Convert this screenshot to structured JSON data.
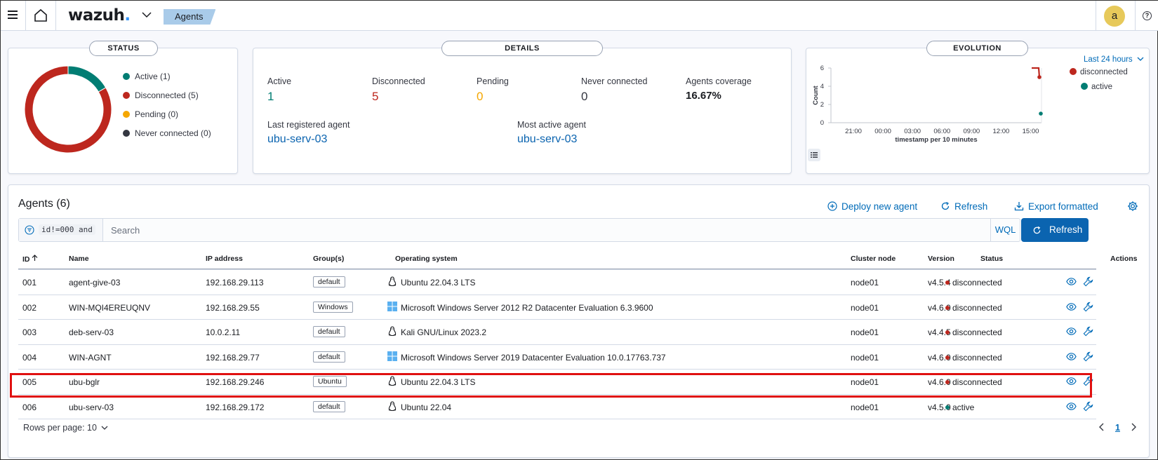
{
  "header": {
    "logo": "wazuh",
    "logo_dot": ".",
    "breadcrumb": "Agents",
    "avatar_letter": "a",
    "help": "?"
  },
  "status_panel": {
    "title": "STATUS",
    "legend": [
      {
        "label": "Active (1)",
        "color": "#017d73"
      },
      {
        "label": "Disconnected (5)",
        "color": "#bd271e"
      },
      {
        "label": "Pending (0)",
        "color": "#f5a700"
      },
      {
        "label": "Never connected (0)",
        "color": "#343741"
      }
    ],
    "donut": {
      "active": 1,
      "disconnected": 5,
      "pending": 0,
      "never_connected": 0
    }
  },
  "details_panel": {
    "title": "DETAILS",
    "stats": [
      {
        "label": "Active",
        "value": "1",
        "color": "#017d73"
      },
      {
        "label": "Disconnected",
        "value": "5",
        "color": "#bd271e"
      },
      {
        "label": "Pending",
        "value": "0",
        "color": "#f5a700"
      },
      {
        "label": "Never connected",
        "value": "0",
        "color": "#343741"
      },
      {
        "label": "Agents coverage",
        "value": "16.67%",
        "color": "#1a1c21"
      }
    ],
    "last_registered_label": "Last registered agent",
    "last_registered_value": "ubu-serv-03",
    "most_active_label": "Most active agent",
    "most_active_value": "ubu-serv-03"
  },
  "evolution_panel": {
    "title": "EVOLUTION",
    "range": "Last 24 hours",
    "legend": [
      {
        "label": "disconnected",
        "color": "#bd271e"
      },
      {
        "label": "active",
        "color": "#017d73"
      }
    ]
  },
  "chart_data": {
    "type": "line",
    "ylabel": "Count",
    "xlabel": "timestamp per 10 minutes",
    "y_ticks": [
      "0",
      "2",
      "4",
      "6"
    ],
    "x_ticks": [
      "21:00",
      "00:00",
      "03:00",
      "06:00",
      "09:00",
      "12:00",
      "15:00"
    ],
    "ylim": [
      0,
      6
    ],
    "series": [
      {
        "name": "disconnected",
        "color": "#bd271e",
        "values": [
          6,
          6,
          5
        ]
      },
      {
        "name": "active",
        "color": "#017d73",
        "values": [
          1
        ]
      }
    ]
  },
  "agents": {
    "title": "Agents (6)",
    "deploy_label": "Deploy new agent",
    "refresh_link_label": "Refresh",
    "export_label": "Export formatted",
    "filter_code": "id!=000 and",
    "search_placeholder": "Search",
    "wql_label": "WQL",
    "refresh_button_label": "Refresh",
    "columns": {
      "id": "ID",
      "name": "Name",
      "ip": "IP address",
      "groups": "Group(s)",
      "os": "Operating system",
      "cluster": "Cluster node",
      "version": "Version",
      "status": "Status",
      "actions": "Actions"
    },
    "rows": [
      {
        "id": "001",
        "name": "agent-give-03",
        "ip": "192.168.29.113",
        "group": "default",
        "os_icon": "linux-icon",
        "os": "Ubuntu 22.04.3 LTS",
        "cluster": "node01",
        "version": "v4.5.4",
        "status": "disconnected",
        "status_color": "#bd271e"
      },
      {
        "id": "002",
        "name": "WIN-MQI4EREUQNV",
        "ip": "192.168.29.55",
        "group": "Windows",
        "os_icon": "windows-icon",
        "os": "Microsoft Windows Server 2012 R2 Datacenter Evaluation 6.3.9600",
        "cluster": "node01",
        "version": "v4.6.0",
        "status": "disconnected",
        "status_color": "#bd271e"
      },
      {
        "id": "003",
        "name": "deb-serv-03",
        "ip": "10.0.2.11",
        "group": "default",
        "os_icon": "linux-icon",
        "os": "Kali GNU/Linux 2023.2",
        "cluster": "node01",
        "version": "v4.4.5",
        "status": "disconnected",
        "status_color": "#bd271e"
      },
      {
        "id": "004",
        "name": "WIN-AGNT",
        "ip": "192.168.29.77",
        "group": "default",
        "os_icon": "windows-icon",
        "os": "Microsoft Windows Server 2019 Datacenter Evaluation 10.0.17763.737",
        "cluster": "node01",
        "version": "v4.6.0",
        "status": "disconnected",
        "status_color": "#bd271e"
      },
      {
        "id": "005",
        "name": "ubu-bglr",
        "ip": "192.168.29.246",
        "group": "Ubuntu",
        "os_icon": "linux-icon",
        "os": "Ubuntu 22.04.3 LTS",
        "cluster": "node01",
        "version": "v4.6.0",
        "status": "disconnected",
        "status_color": "#bd271e"
      },
      {
        "id": "006",
        "name": "ubu-serv-03",
        "ip": "192.168.29.172",
        "group": "default",
        "os_icon": "linux-icon",
        "os": "Ubuntu 22.04",
        "cluster": "node01",
        "version": "v4.5.0",
        "status": "active",
        "status_color": "#017d73"
      }
    ],
    "rows_per_page": "Rows per page: 10",
    "current_page": "1"
  }
}
